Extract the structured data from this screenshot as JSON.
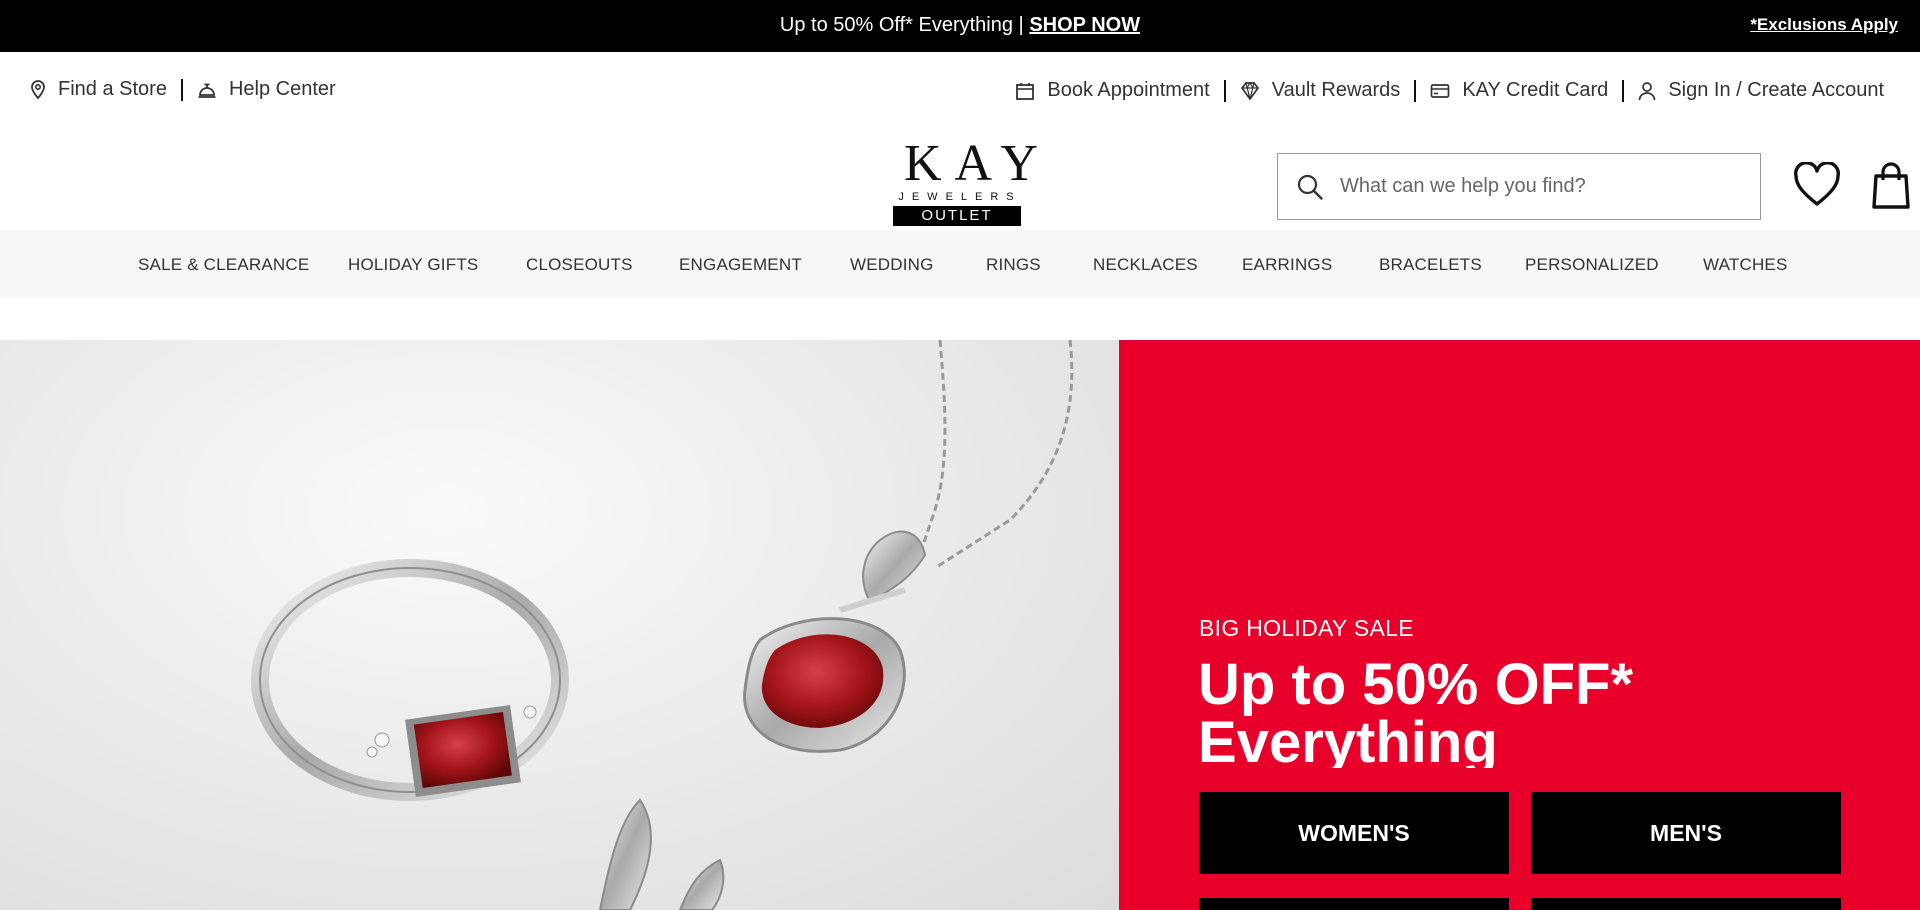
{
  "promo": {
    "text": "Up to 50% Off* Everything |",
    "link": "SHOP NOW",
    "exclusions": "*Exclusions Apply"
  },
  "utility": {
    "find_store": "Find a Store",
    "help_center": "Help Center",
    "book_appointment": "Book Appointment",
    "vault_rewards": "Vault Rewards",
    "credit_card": "KAY Credit Card",
    "sign_in": "Sign In / Create Account"
  },
  "logo": {
    "name": "KAY",
    "sub": "JEWELERS",
    "tag": "OUTLET"
  },
  "search": {
    "placeholder": "What can we help you find?"
  },
  "nav": {
    "items": [
      "SALE & CLEARANCE",
      "HOLIDAY GIFTS",
      "CLOSEOUTS",
      "ENGAGEMENT",
      "WEDDING",
      "RINGS",
      "NECKLACES",
      "EARRINGS",
      "BRACELETS",
      "PERSONALIZED",
      "WATCHES"
    ]
  },
  "hero": {
    "eyebrow": "BIG HOLIDAY SALE",
    "headline": "Up to 50% OFF* Everything",
    "cta_womens": "WOMEN'S",
    "cta_mens": "MEN'S"
  },
  "colors": {
    "promo_bg": "#000000",
    "nav_bg": "#f7f7f7",
    "hero_panel": "#e9002a",
    "cta_bg": "#000000",
    "gem": "#a31419"
  }
}
